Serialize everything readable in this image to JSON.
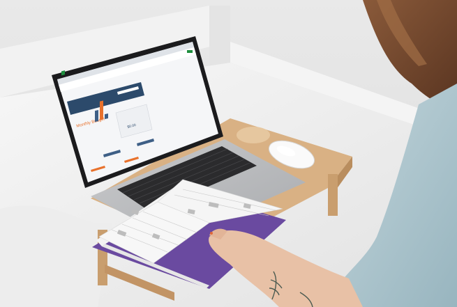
{
  "screen": {
    "budget_title": "Monthly Budget",
    "summary_value": "$0.00"
  },
  "colors": {
    "sheet_header": "#2c4a6b",
    "accent_orange": "#e8712c",
    "bar_blue": "#3e5f86",
    "planner_cover": "#6a4aa0",
    "desk_wood": "#d9b184",
    "sheets_green": "#1e8e3e"
  },
  "icons": {
    "sheets_app": "sheets-icon",
    "mouse": "mouse-icon"
  }
}
